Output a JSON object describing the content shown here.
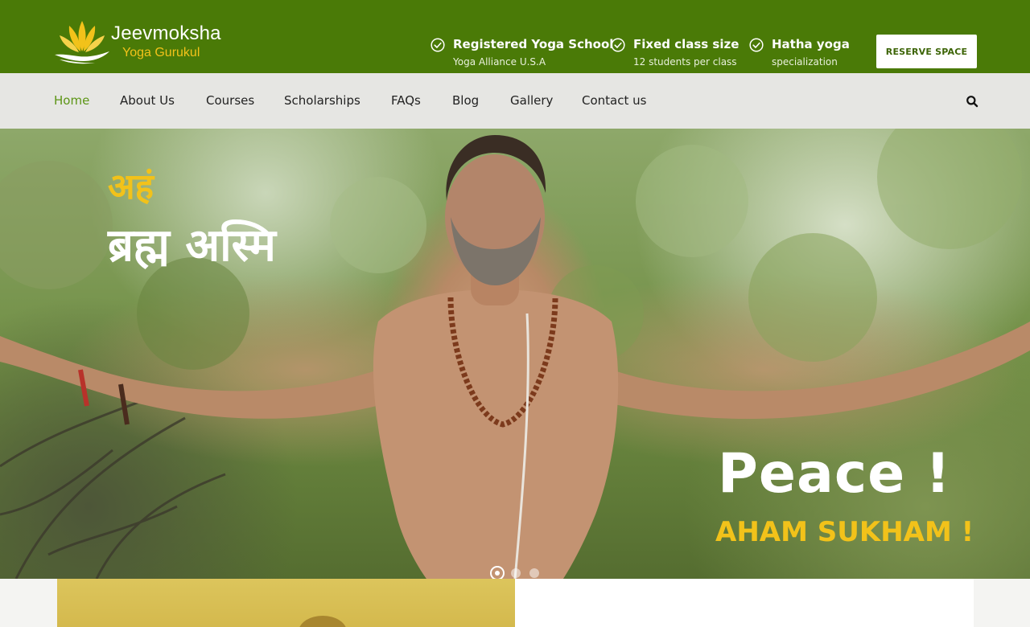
{
  "header": {
    "logo": {
      "name": "Jeevmoksha",
      "subtitle": "Yoga Gurukul"
    },
    "features": [
      {
        "title": "Registered Yoga School",
        "subtitle": "Yoga Alliance U.S.A",
        "icon": "check-circle-icon"
      },
      {
        "title": "Fixed class size",
        "subtitle": "12 students per class",
        "icon": "check-circle-icon"
      },
      {
        "title": "Hatha yoga",
        "subtitle": "specialization",
        "icon": "check-circle-icon"
      }
    ],
    "reserve_label": "RESERVE SPACE"
  },
  "nav": {
    "items": [
      "Home",
      "About Us",
      "Courses",
      "Scholarships",
      "FAQs",
      "Blog",
      "Gallery",
      "Contact us"
    ],
    "active": "Home",
    "search_icon": "search-icon"
  },
  "hero": {
    "devanagari_line1": "अहं",
    "devanagari_line2": "ब्रह्म अस्मि",
    "title": "Peace !",
    "subtitle": "AHAM SUKHAM !",
    "slides_total": 3,
    "active_slide": 1
  },
  "colors": {
    "header_green": "#4a7a07",
    "nav_bg": "#e6e6e3",
    "active_nav": "#5c9515",
    "accent_yellow": "#f2c21a"
  }
}
